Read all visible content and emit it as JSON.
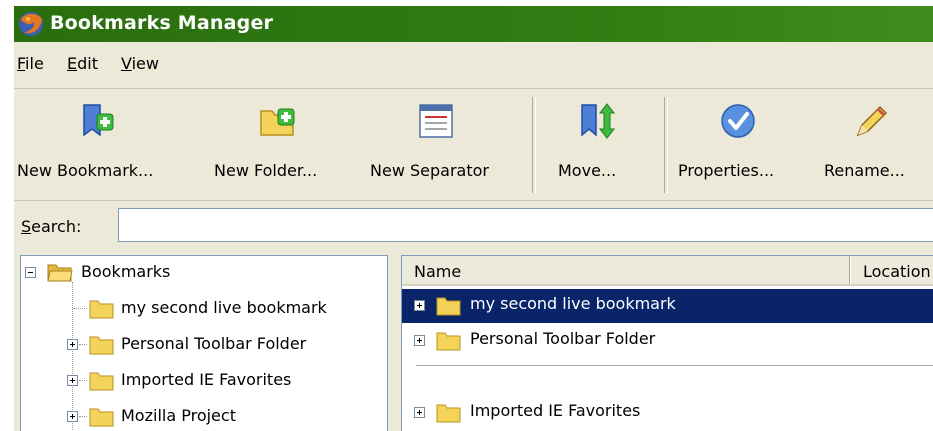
{
  "window": {
    "title": "Bookmarks Manager"
  },
  "menu": [
    {
      "label": "File",
      "u": "F"
    },
    {
      "label": "Edit",
      "u": "E"
    },
    {
      "label": "View",
      "u": "V"
    }
  ],
  "toolbar": {
    "new_bookmark": "New Bookmark...",
    "new_folder": "New Folder...",
    "new_separator": "New Separator",
    "move": "Move...",
    "properties": "Properties...",
    "rename": "Rename..."
  },
  "search": {
    "label": "Search:",
    "value": ""
  },
  "tree": {
    "root": "Bookmarks",
    "items": [
      "my second live bookmark",
      "Personal Toolbar Folder",
      "Imported IE Favorites",
      "Mozilla Project"
    ]
  },
  "list": {
    "columns": [
      "Name",
      "Location"
    ],
    "rows": [
      "my second live bookmark",
      "Personal Toolbar Folder",
      "Imported IE Favorites"
    ]
  },
  "colors": {
    "titlebar": "#2f7d12",
    "selection": "#0a246a",
    "chrome": "#ece9d8"
  },
  "icons": {
    "app": "firefox-logo-icon",
    "new_bookmark": "new-bookmark-icon",
    "new_folder": "new-folder-icon",
    "new_separator": "new-separator-icon",
    "move": "move-icon",
    "properties": "properties-icon",
    "rename": "rename-icon",
    "folder": "folder-icon"
  }
}
